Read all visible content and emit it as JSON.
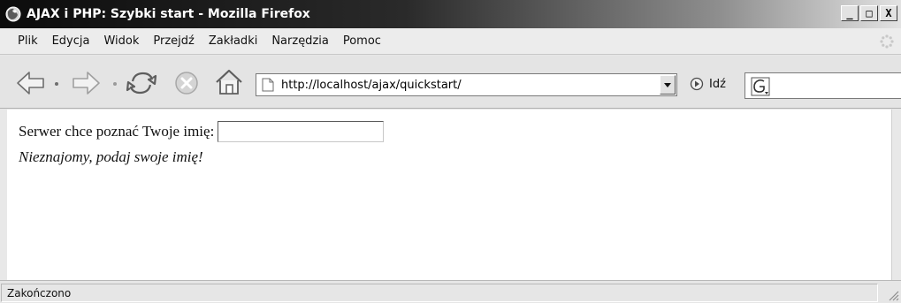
{
  "window": {
    "title": "AJAX i PHP: Szybki start - Mozilla Firefox",
    "controls": {
      "minimize": "_",
      "maximize": "□",
      "close": "X"
    }
  },
  "menu": {
    "items": [
      "Plik",
      "Edycja",
      "Widok",
      "Przejdź",
      "Zakładki",
      "Narzędzia",
      "Pomoc"
    ]
  },
  "toolbar": {
    "icons": [
      "back-arrow-icon",
      "forward-arrow-icon",
      "reload-icon",
      "stop-icon",
      "home-icon"
    ],
    "url": "http://localhost/ajax/quickstart/",
    "go_label": "Idź",
    "search_value": ""
  },
  "page": {
    "prompt": "Serwer chce poznać Twoje imię:",
    "name_value": "",
    "response": "Nieznajomy, podaj swoje imię!"
  },
  "status": {
    "text": "Zakończono"
  }
}
